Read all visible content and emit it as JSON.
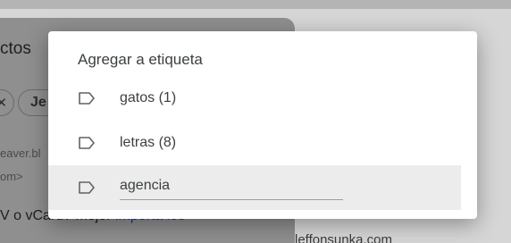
{
  "background": {
    "panel_title": "ctos",
    "chips": [
      "✕",
      "Je"
    ],
    "email_line1": "eaver.bl",
    "email_line2": "om>",
    "body_text_prefix": "V o vCard? Mejor ",
    "body_link": "importa los",
    "right_text": "leffonsunka.com"
  },
  "dialog": {
    "title": "Agregar a etiqueta",
    "labels": [
      {
        "icon": "label-outline-icon",
        "text": "gatos (1)"
      },
      {
        "icon": "label-outline-icon",
        "text": "letras (8)"
      }
    ],
    "new_label": {
      "icon": "label-outline-icon",
      "value": "agencia"
    }
  },
  "colors": {
    "highlight": "#ececec",
    "text": "#3c4043",
    "scrim": "#d6d6d6"
  }
}
